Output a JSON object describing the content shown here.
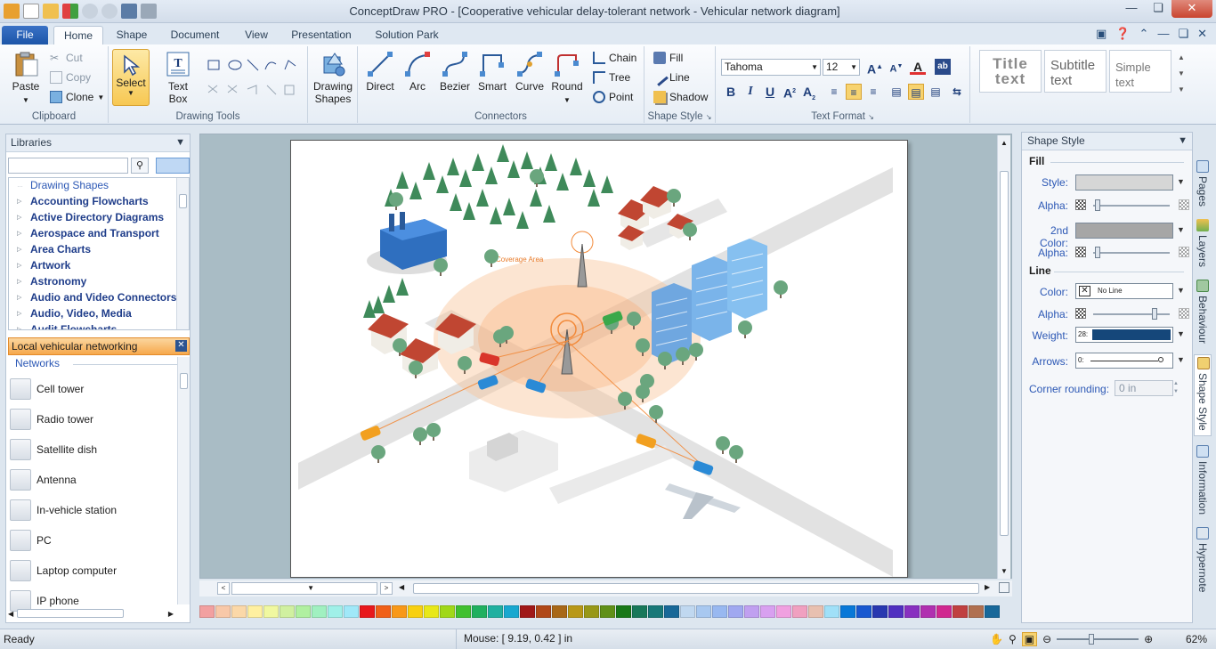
{
  "window": {
    "title": "ConceptDraw PRO - [Cooperative vehicular delay-tolerant network - Vehicular network diagram]"
  },
  "tabs": [
    "File",
    "Home",
    "Shape",
    "Document",
    "View",
    "Presentation",
    "Solution Park"
  ],
  "ribbon": {
    "clipboard": {
      "label": "Clipboard",
      "paste": "Paste",
      "cut": "Cut",
      "copy": "Copy",
      "clone": "Clone"
    },
    "drawing_tools": {
      "label": "Drawing Tools",
      "select": "Select",
      "text_box_line1": "Text",
      "text_box_line2": "Box"
    },
    "drawing_shapes": {
      "line1": "Drawing",
      "line2": "Shapes"
    },
    "connectors": {
      "label": "Connectors",
      "direct": "Direct",
      "arc": "Arc",
      "bezier": "Bezier",
      "smart": "Smart",
      "curve": "Curve",
      "round": "Round",
      "chain": "Chain",
      "tree": "Tree",
      "point": "Point"
    },
    "shape_style": {
      "label": "Shape Style",
      "fill": "Fill",
      "line": "Line",
      "shadow": "Shadow"
    },
    "text_format": {
      "label": "Text Format",
      "font": "Tahoma",
      "size": "12"
    },
    "styles": {
      "title_line1": "Title",
      "title_line2": "text",
      "subtitle_line1": "Subtitle",
      "subtitle_line2": "text",
      "simple_line1": "Simple",
      "simple_line2": "text"
    }
  },
  "libraries": {
    "title": "Libraries",
    "tree": [
      "Drawing Shapes",
      "Accounting Flowcharts",
      "Active Directory Diagrams",
      "Aerospace and Transport",
      "Area Charts",
      "Artwork",
      "Astronomy",
      "Audio and Video Connectors",
      "Audio, Video, Media",
      "Audit Flowcharts"
    ],
    "active_library": "Local vehicular networking",
    "section": "Networks",
    "items": [
      "Cell tower",
      "Radio tower",
      "Satellite dish",
      "Antenna",
      "In-vehicle station",
      "PC",
      "Laptop computer",
      "IP phone"
    ]
  },
  "diagram": {
    "coverage_label": "Coverage Area"
  },
  "shape_style": {
    "title": "Shape Style",
    "fill_section": "Fill",
    "style_label": "Style:",
    "alpha_label": "Alpha:",
    "second_color_label": "2nd Color:",
    "line_section": "Line",
    "color_label": "Color:",
    "line_color_value": "No Line",
    "weight_label": "Weight:",
    "weight_value": "28:",
    "arrows_label": "Arrows:",
    "arrows_value": "0:",
    "corner_label": "Corner rounding:",
    "corner_value": "0 in"
  },
  "side_tabs": [
    "Pages",
    "Layers",
    "Behaviour",
    "Shape Style",
    "Information",
    "Hypernote"
  ],
  "status": {
    "ready": "Ready",
    "mouse": "Mouse: [ 9.19, 0.42 ] in",
    "zoom": "62%"
  },
  "palette": [
    "#f2a0a0",
    "#f8c8a8",
    "#fbd8a8",
    "#fff0a0",
    "#f0f8a0",
    "#d0f0a0",
    "#b0f0a0",
    "#a0f0c0",
    "#a0f0e8",
    "#a0e8f8",
    "#e8181c",
    "#f06018",
    "#f89818",
    "#f8d010",
    "#e8e818",
    "#a0d818",
    "#40c030",
    "#20b060",
    "#20b0a0",
    "#18a8d0",
    "#a01818",
    "#b04818",
    "#a86818",
    "#b89818",
    "#989818",
    "#609018",
    "#187818",
    "#18785a",
    "#187878",
    "#186898",
    "#c0d8f0",
    "#a8c8f0",
    "#98b8f0",
    "#a0a8f0",
    "#c0a0f0",
    "#d8a0f0",
    "#f0a0e0",
    "#f0a0c0",
    "#e8c0b0",
    "#a0e0f8",
    "#0878d8",
    "#1858d0",
    "#2838b0",
    "#5030c0",
    "#8830c0",
    "#b030b0",
    "#d02890",
    "#c04040",
    "#b07050",
    "#18689a"
  ],
  "colors": {
    "accent": "#f6a84c",
    "selection": "#f7c853",
    "coverage": "#f7a56a"
  }
}
